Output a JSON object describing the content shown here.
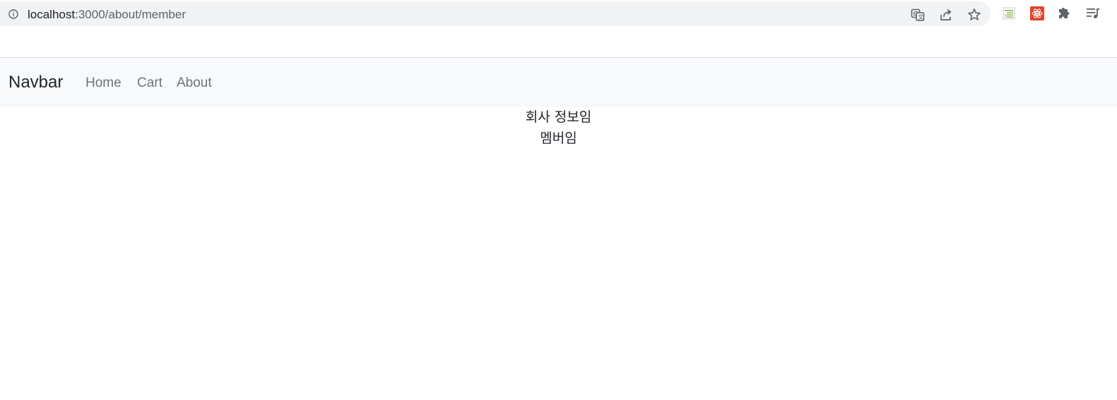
{
  "browser": {
    "url_host": "localhost",
    "url_path": ":3000/about/member",
    "icons": [
      "info-icon",
      "translate-icon",
      "share-icon",
      "bookmark-star-icon",
      "extension-sheet-icon",
      "extension-react-icon",
      "extensions-puzzle-icon",
      "media-queue-icon"
    ]
  },
  "navbar": {
    "brand": "Navbar",
    "links": [
      {
        "label": "Home"
      },
      {
        "label": "Cart"
      },
      {
        "label": "About"
      }
    ],
    "background": "#f8f9fa",
    "link_color": "#6c757d"
  },
  "main": {
    "company_text": "회사 정보임",
    "member_text": "멤버임"
  }
}
